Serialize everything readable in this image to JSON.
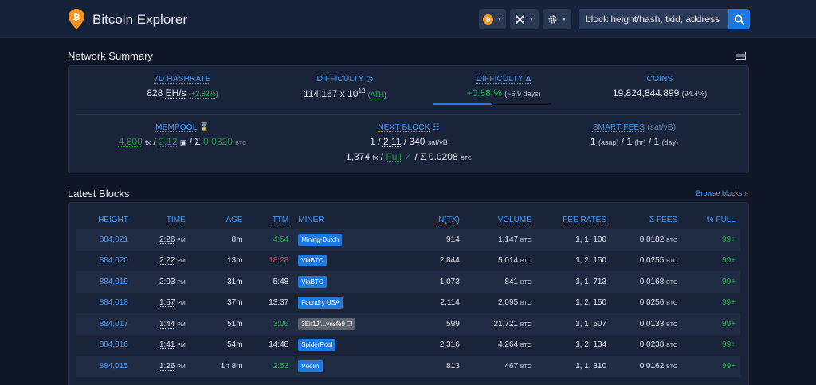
{
  "header": {
    "brand": "Bitcoin Explorer",
    "search_placeholder": "block height/hash, txid, address",
    "icons": [
      "bitcoin-icon",
      "tools-icon",
      "settings-icon",
      "search-icon"
    ]
  },
  "summary": {
    "title": "Network Summary",
    "hashrate": {
      "label": "7D HASHRATE",
      "value": "828",
      "unit": "EH/s",
      "change": "+2.82%"
    },
    "difficulty": {
      "label": "DIFFICULTY",
      "value": "114.167 x 10",
      "exp": "12",
      "note": "ATH"
    },
    "difficulty_delta": {
      "label": "DIFFICULTY Δ",
      "value": "+0.88 %",
      "eta": "(~6.9 days)",
      "progress": 0.5
    },
    "coins": {
      "label": "COINS",
      "value": "19,824,844.899",
      "pct": "(94.4%)"
    },
    "mempool": {
      "label": "MEMPOOL",
      "tx": "4,600",
      "tx_unit": "tx",
      "size": "2.12",
      "fees_prefix": "Σ",
      "fees": "0.0320",
      "fees_unit": "BTC"
    },
    "next_block": {
      "label": "NEXT BLOCK",
      "line1_a": "1",
      "line1_b": "2.11",
      "line1_c": "340",
      "line1_unit": "sat/vB",
      "tx": "1,374",
      "tx_unit": "tx",
      "status": "Full",
      "fees": "Σ 0.0208",
      "fees_unit": "BTC"
    },
    "smart_fees": {
      "label": "SMART FEES",
      "unit": "(sat/vB)",
      "asap": "1",
      "asap_label": "(asap)",
      "hr": "1",
      "hr_label": "(hr)",
      "day": "1",
      "day_label": "(day)"
    }
  },
  "blocks": {
    "title": "Latest Blocks",
    "browse": "Browse blocks »",
    "columns": {
      "height": "HEIGHT",
      "time": "TIME",
      "age": "AGE",
      "ttm": "TTM",
      "miner": "MINER",
      "ntx": "N(TX)",
      "volume": "VOLUME",
      "fee_rates": "FEE RATES",
      "fees": "Σ FEES",
      "full": "% FULL"
    },
    "units": {
      "time": "PM",
      "btc": "BTC"
    },
    "rows": [
      {
        "height": "884,021",
        "time": "2:26",
        "age": "8m",
        "ttm": "4:54",
        "ttm_color": "green",
        "miner": "Mining-Dutch",
        "miner_grey": false,
        "ntx": "914",
        "volume": "1,147",
        "fee_rates": "1, 1, 100",
        "fees": "0.0182",
        "full": "99+"
      },
      {
        "height": "884,020",
        "time": "2:22",
        "age": "13m",
        "ttm": "18:28",
        "ttm_color": "red",
        "miner": "ViaBTC",
        "miner_grey": false,
        "ntx": "2,844",
        "volume": "5,014",
        "fee_rates": "1, 2, 150",
        "fees": "0.0255",
        "full": "99+"
      },
      {
        "height": "884,019",
        "time": "2:03",
        "age": "31m",
        "ttm": "5:48",
        "ttm_color": "white",
        "miner": "ViaBTC",
        "miner_grey": false,
        "ntx": "1,073",
        "volume": "841",
        "fee_rates": "1, 1, 713",
        "fees": "0.0168",
        "full": "99+"
      },
      {
        "height": "884,018",
        "time": "1:57",
        "age": "37m",
        "ttm": "13:37",
        "ttm_color": "white",
        "miner": "Foundry USA",
        "miner_grey": false,
        "ntx": "2,114",
        "volume": "2,095",
        "fee_rates": "1, 2, 150",
        "fees": "0.0256",
        "full": "99+"
      },
      {
        "height": "884,017",
        "time": "1:44",
        "age": "51m",
        "ttm": "3:06",
        "ttm_color": "green",
        "miner": "3Eif1Jf...vnsfe9",
        "miner_grey": true,
        "ntx": "599",
        "volume": "21,721",
        "fee_rates": "1, 1, 507",
        "fees": "0.0133",
        "full": "99+"
      },
      {
        "height": "884,016",
        "time": "1:41",
        "age": "54m",
        "ttm": "14:48",
        "ttm_color": "white",
        "miner": "SpiderPool",
        "miner_grey": false,
        "ntx": "2,316",
        "volume": "4,264",
        "fee_rates": "1, 2, 134",
        "fees": "0.0238",
        "full": "99+"
      },
      {
        "height": "884,015",
        "time": "1:26",
        "age": "1h 8m",
        "ttm": "2:53",
        "ttm_color": "green",
        "miner": "Poolin",
        "miner_grey": false,
        "ntx": "813",
        "volume": "467",
        "fee_rates": "1, 1, 310",
        "fees": "0.0162",
        "full": "99+"
      }
    ]
  },
  "colors": {
    "accent": "#1e7ae0",
    "link": "#4a9bf5",
    "green": "#27b052",
    "red": "#e0444f",
    "bitcoin": "#f7931a"
  }
}
